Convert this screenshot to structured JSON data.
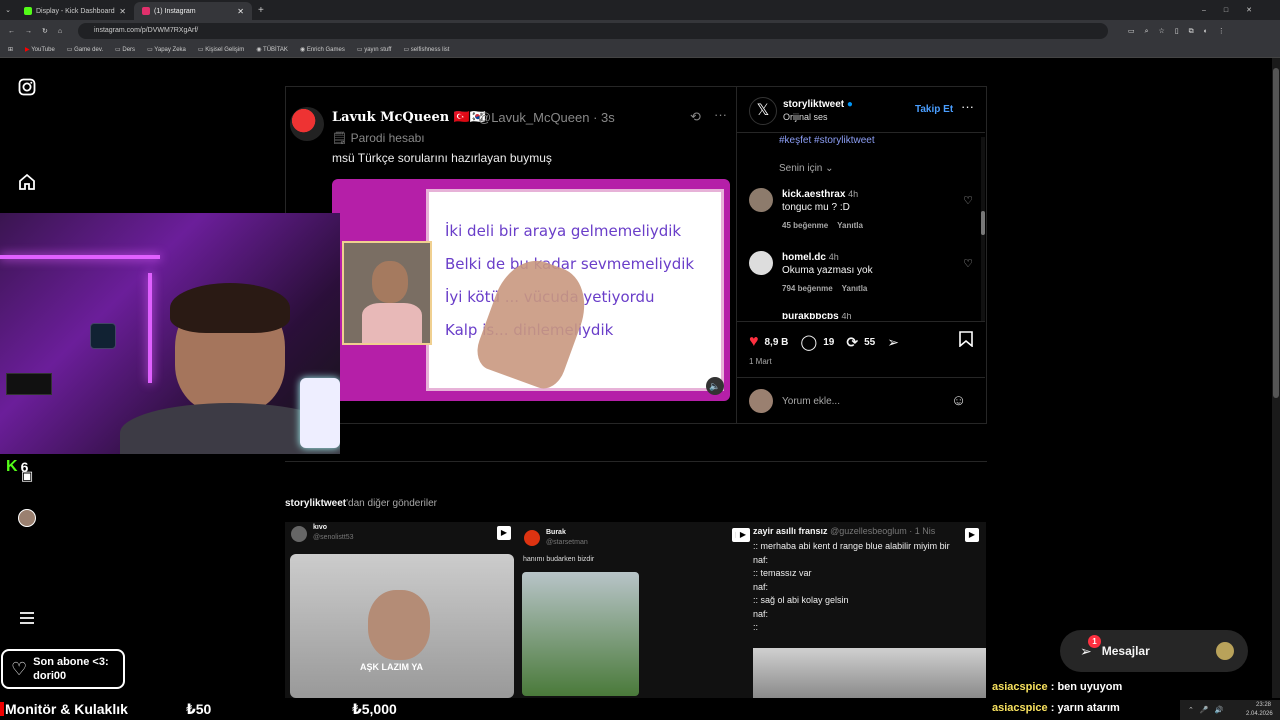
{
  "browser": {
    "tabs": [
      {
        "title": "Display - Kick Dashboard",
        "favicon_color": "#53fc18"
      },
      {
        "title": "(1) Instagram",
        "favicon_color": "#e1306c"
      }
    ],
    "url": "instagram.com/p/DVWM7RXgArf/",
    "bookmarks": [
      "YouTube",
      "Game dev.",
      "Ders",
      "Yapay Zeka",
      "Kişisel Gelişim",
      "TÜBİTAK",
      "Enrich Games",
      "yayın stuff",
      "selfishness list"
    ]
  },
  "post": {
    "tweet": {
      "name": "Lavuk McQueen",
      "flags": "🇹🇷🇰🇷",
      "handle": "@Lavuk_McQueen · 3s",
      "parody": "Parodi hesabı",
      "text": "msü Türkçe sorularını hazırlayan buymuş"
    },
    "whiteboard_lines": [
      "İki deli bir araya gelmemeliydik",
      "Belki de bu kadar sevmemeliydik",
      "İyi kötü ... vücuda yetiyordu",
      "Kalp is... dinlemeliydik"
    ],
    "author": {
      "name": "storyliktweet",
      "subtitle": "Orijinal ses",
      "follow": "Takip Et"
    },
    "hashtags": "#keşfet #storyliktweet",
    "sort_label": "Senin için",
    "comments": [
      {
        "user": "kick.aesthrax",
        "time": "4h",
        "text": "tonguc mu ? :D",
        "likes": "45 beğenme",
        "reply": "Yanıtla"
      },
      {
        "user": "homel.dc",
        "time": "4h",
        "text": "Okuma yazması yok",
        "likes": "794 beğenme",
        "reply": "Yanıtla"
      },
      {
        "user": "burakbbcbs",
        "time": "4h"
      }
    ],
    "stats": {
      "likes": "8,9 B",
      "comments": "19",
      "reposts": "55"
    },
    "date": "1 Mart",
    "comment_placeholder": "Yorum ekle..."
  },
  "more": {
    "title_bold": "storyliktweet",
    "title_rest": "'dan diğer gönderiler",
    "cards": [
      {
        "user": "kıvo",
        "handle": "@senolistt53",
        "caption": "AŞK LAZIM YA"
      },
      {
        "user": "Burak",
        "handle": "@starsetman",
        "caption": "hanımı budarken bizdir"
      },
      {
        "user": "zayir asıllı fransız",
        "handle": "@guzellesbeoglum · 1 Nis",
        "lines": [
          ":: merhaba abi kent d range blue alabilir miyim bir",
          "naf:",
          ":: temassız var",
          "naf:",
          ":: sağ ol abi kolay gelsin",
          "naf:",
          "::"
        ]
      }
    ]
  },
  "overlay": {
    "kick_count": "6",
    "sub_label": "Son abone <3:",
    "sub_name": "dori00",
    "messages": "Mesajlar",
    "messages_badge": "1",
    "chat": [
      {
        "user": "asiacspice",
        "text": ": ben uyuyom"
      },
      {
        "user": "asiacspice",
        "text": ": yarın atarım"
      }
    ],
    "bottom_left": "Monitör & Kulaklık",
    "price1": "₺50",
    "price2": "₺5,000",
    "clock": "23:28",
    "date": "2.04.2026"
  },
  "colors": {
    "accent": "#0095f6",
    "kick": "#53fc18",
    "like": "#ff3040"
  }
}
